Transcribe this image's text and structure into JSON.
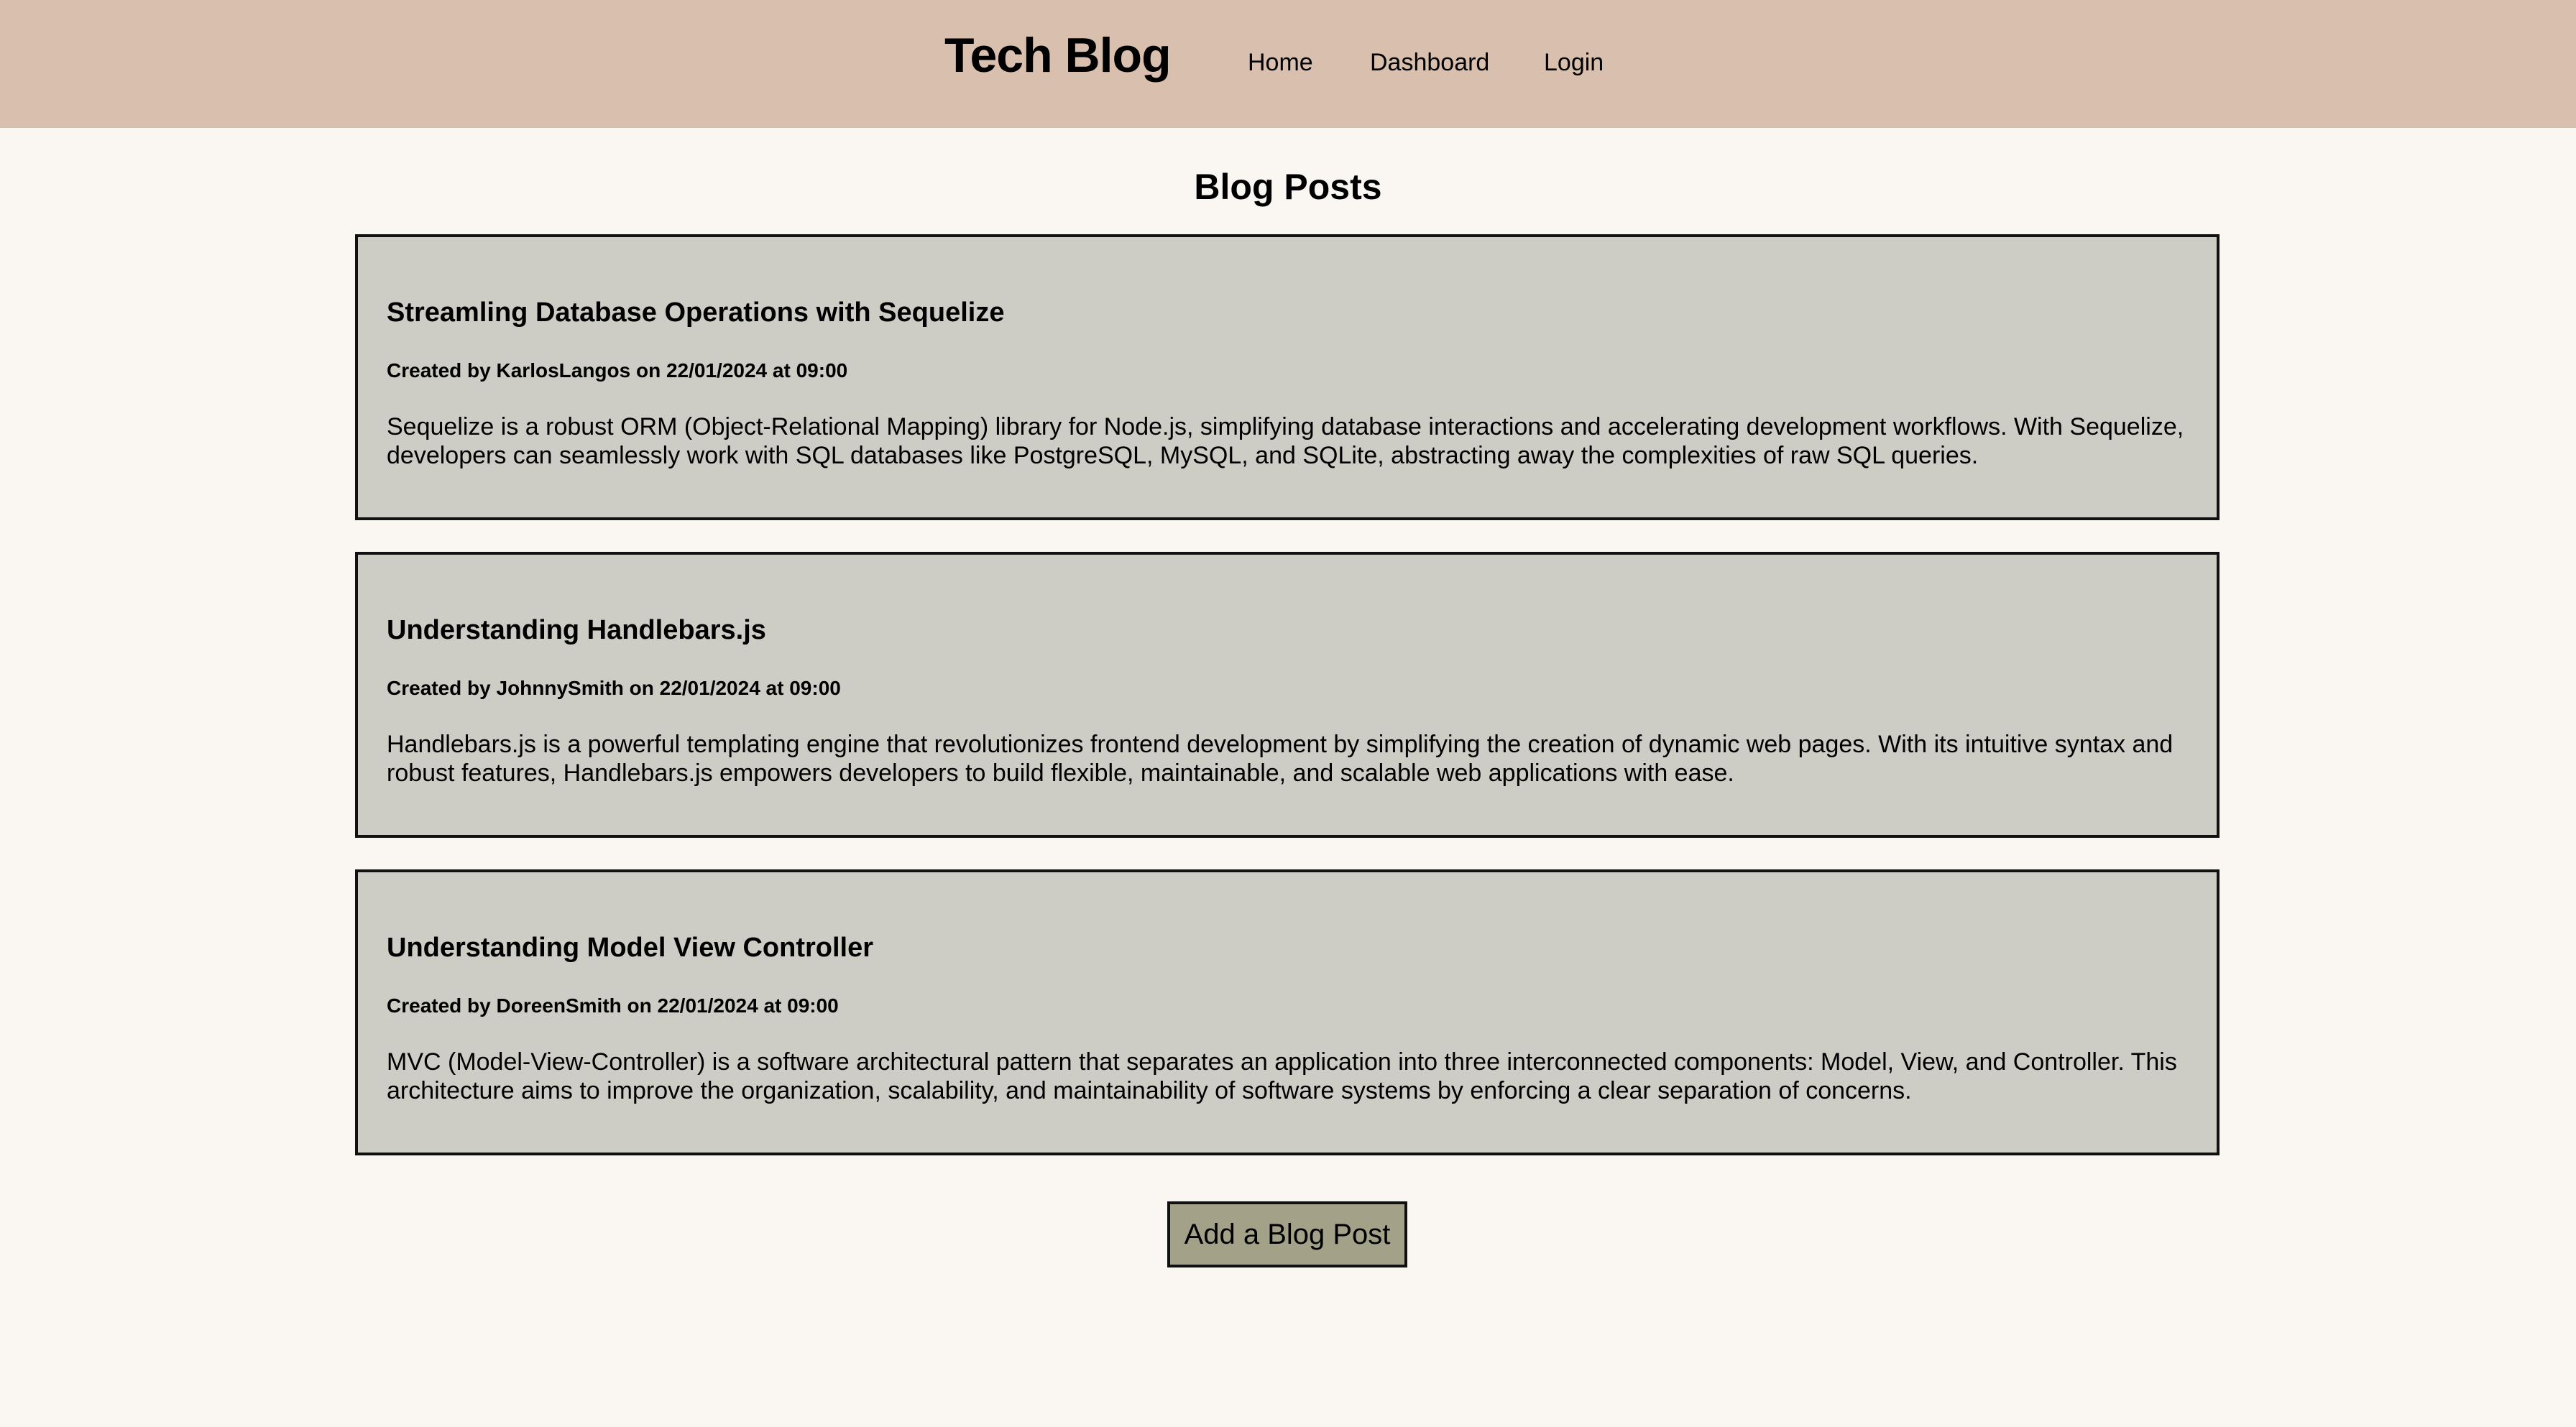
{
  "header": {
    "title": "Tech Blog",
    "nav": {
      "home": "Home",
      "dashboard": "Dashboard",
      "login": "Login"
    }
  },
  "main": {
    "heading": "Blog Posts",
    "posts": [
      {
        "title": "Streamling Database Operations with Sequelize",
        "created_prefix": "Created by",
        "author": "KarlosLangos",
        "on_word": "on",
        "date": "22/01/2024",
        "at_word": "at",
        "time": "09:00",
        "body": "Sequelize is a robust ORM (Object-Relational Mapping) library for Node.js, simplifying database interactions and accelerating development workflows. With Sequelize, developers can seamlessly work with SQL databases like PostgreSQL, MySQL, and SQLite, abstracting away the complexities of raw SQL queries."
      },
      {
        "title": "Understanding Handlebars.js",
        "created_prefix": "Created by",
        "author": "JohnnySmith",
        "on_word": "on",
        "date": "22/01/2024",
        "at_word": "at",
        "time": "09:00",
        "body": "Handlebars.js is a powerful templating engine that revolutionizes frontend development by simplifying the creation of dynamic web pages. With its intuitive syntax and robust features, Handlebars.js empowers developers to build flexible, maintainable, and scalable web applications with ease."
      },
      {
        "title": "Understanding Model View Controller",
        "created_prefix": "Created by",
        "author": "DoreenSmith",
        "on_word": "on",
        "date": "22/01/2024",
        "at_word": "at",
        "time": "09:00",
        "body": "MVC (Model-View-Controller) is a software architectural pattern that separates an application into three interconnected components: Model, View, and Controller. This architecture aims to improve the organization, scalability, and maintainability of software systems by enforcing a clear separation of concerns."
      }
    ],
    "add_button_label": "Add a Blog Post"
  },
  "colors": {
    "header_bg": "#d9bfad",
    "page_bg": "#faf6f2",
    "card_bg": "#cdcdc5",
    "button_bg": "#a3a289"
  }
}
